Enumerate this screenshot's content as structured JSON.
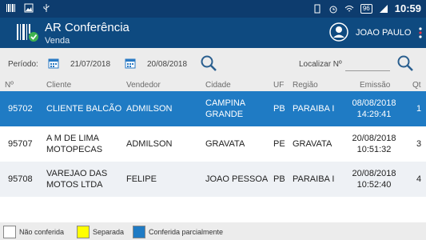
{
  "status_bar": {
    "time": "10:59",
    "battery": "96"
  },
  "app": {
    "title": "AR Conferência",
    "subtitle": "Venda",
    "user": "JOAO PAULO"
  },
  "filters": {
    "period_label": "Período:",
    "date_from": "21/07/2018",
    "date_to": "20/08/2018",
    "locate_label": "Localizar Nº",
    "locate_value": ""
  },
  "table": {
    "headers": [
      "Nº",
      "Cliente",
      "Vendedor",
      "Cidade",
      "UF",
      "Região",
      "Emissão",
      "Qt"
    ],
    "rows": [
      {
        "no": "95702",
        "cliente": "CLIENTE BALCÃO",
        "vendedor": "ADMILSON",
        "cidade": "CAMPINA GRANDE",
        "uf": "PB",
        "regiao": "PARAIBA I",
        "data": "08/08/2018",
        "hora": "14:29:41",
        "qt": "1",
        "state": "parcial"
      },
      {
        "no": "95707",
        "cliente": "A M DE LIMA MOTOPECAS",
        "vendedor": "ADMILSON",
        "cidade": "GRAVATA",
        "uf": "PE",
        "regiao": "GRAVATA",
        "data": "20/08/2018",
        "hora": "10:51:32",
        "qt": "3",
        "state": "nao"
      },
      {
        "no": "95708",
        "cliente": "VAREJAO DAS MOTOS LTDA",
        "vendedor": "FELIPE",
        "cidade": "JOAO PESSOA",
        "uf": "PB",
        "regiao": "PARAIBA I",
        "data": "20/08/2018",
        "hora": "10:52:40",
        "qt": "4",
        "state": "nao"
      }
    ]
  },
  "legend": {
    "items": [
      {
        "label": "Não conferida",
        "color": "#ffffff"
      },
      {
        "label": "Separada",
        "color": "#ffff00"
      },
      {
        "label": "Conferida parcialmente",
        "color": "#1f7bc4"
      }
    ]
  },
  "colors": {
    "appbar": "#0e4a80",
    "statusbar": "#0d3c6e",
    "selected_row": "#1f7bc4"
  }
}
